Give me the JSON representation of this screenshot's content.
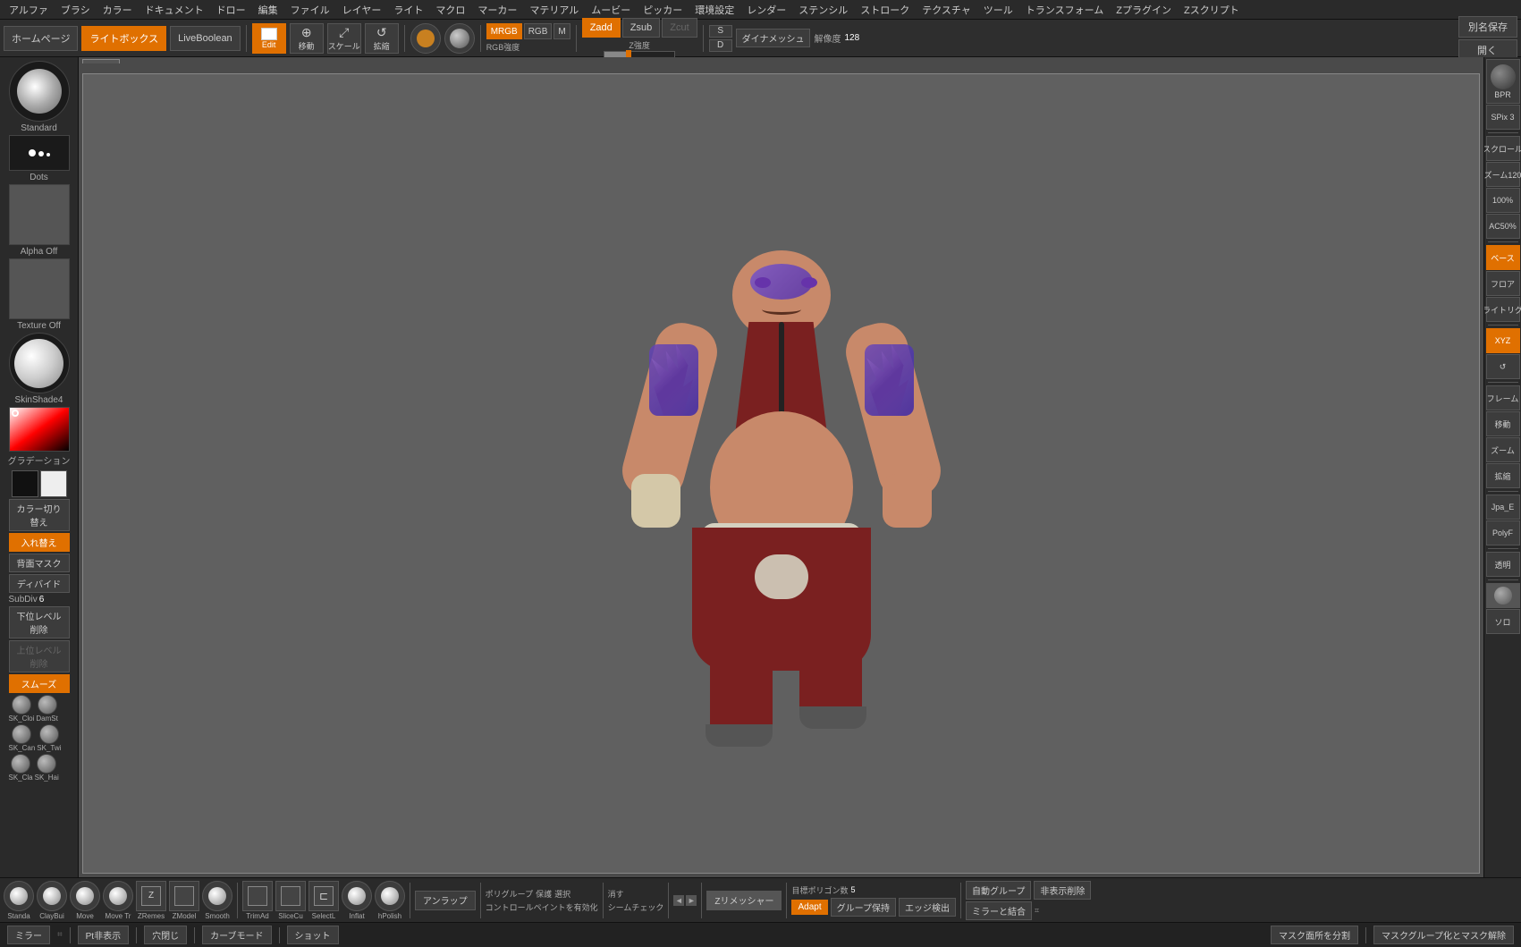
{
  "topMenu": {
    "items": [
      "アルファ",
      "ブラシ",
      "カラー",
      "ドキュメント",
      "ドロー",
      "編集",
      "ファイル",
      "レイヤー",
      "ライト",
      "マクロ",
      "マーカー",
      "マテリアル",
      "ムービー",
      "ピッカー",
      "環境設定",
      "レンダー",
      "ステンシル",
      "ストローク",
      "テクスチャ",
      "ツール",
      "トランスフォーム",
      "Zプラグイン",
      "Zスクリプト"
    ]
  },
  "toolbar": {
    "homeBtn": "ホームページ",
    "lightboxBtn": "ライトボックス",
    "liveBoolBtn": "LiveBoolean",
    "editBtn": "Edit",
    "moveBtn": "移動",
    "scaleBtn": "スケール",
    "rotateBtn": "拡縮",
    "mrgbLabel": "MRGB",
    "rgbLabel": "RGB",
    "mLabel": "M",
    "zaddLabel": "Zadd",
    "zsubLabel": "Zsub",
    "zcutLabel": "Zcut",
    "zIntensityLabel": "Z強度",
    "zIntensityValue": "25",
    "rgbIntensityLabel": "RGB強度",
    "dynameshLabel": "ダイナメッシュ",
    "kaizodoLabel": "解像度",
    "kaizodoValue": "128",
    "betsumeiLabel": "別名保存",
    "hirakulLabel": "開く",
    "sBtn": "S",
    "dBtn": "D"
  },
  "leftPanel": {
    "brushLabel": "Standard",
    "dotsLabel": "Dots",
    "alphaLabel": "Alpha Off",
    "textureLabel": "Texture Off",
    "materialLabel": "SkinShade4",
    "gradLabel": "グラデーション",
    "colorToggleLabel": "カラー切り替え",
    "irekaeLabel": "入れ替え",
    "backMaskLabel": "背面マスク",
    "dibideLabel": "ディバイド",
    "subdivLabel": "SubDiv",
    "subdivValue": "6",
    "lowerDeleteLabel": "下位レベル削除",
    "upperDeleteLabel": "上位レベル削除",
    "smoothLabel": "スムーズ",
    "brush1": "SK_Cloi",
    "brush2": "DamSt",
    "brush3": "SK_Can",
    "brush4": "SK_Twi",
    "brush5": "SK_Cla",
    "brush6": "SK_Hai"
  },
  "rightPanel": {
    "bprLabel": "BPR",
    "spixLabel": "SPix 3",
    "scroll1": "スクロール",
    "zoom1": "ズーム120",
    "zoom2": "100%",
    "ac1": "AC50%",
    "baseLabel": "ベース",
    "floorLabel": "フロア",
    "lightrig": "ライトリグ",
    "xyzLabel": "XYZ",
    "btn1": "フレーム",
    "btn2": "移動",
    "btn3": "ズーム",
    "btn4": "拡縮",
    "btn5": "Jpa_E",
    "btn6": "PolyF",
    "transparentLabel": "透明",
    "soloLabel": "ソロ"
  },
  "bottomToolbar": {
    "brushes": [
      "Standa",
      "ClayBui",
      "Move",
      "Move Tr",
      "ZRemes",
      "ZModel",
      "Smooth"
    ],
    "tools": [
      "TrimAd",
      "SliceCu",
      "SelectL",
      "Inflat",
      "hPolish"
    ],
    "anrapBtn": "アンラップ",
    "polygroupLabel": "ポリグループ",
    "hozonLabel": "保護",
    "sentakuLabel": "選択",
    "kesuLabel": "消す",
    "shimcheckLabel": "シームチェック",
    "zremesherBtn": "Zリメッシャー",
    "targetPolyLabel": "目標ポリゴン数",
    "targetPolyValue": "5",
    "adaptBtn": "Adapt",
    "groupHoldBtn": "グループ保持",
    "edgeDetectBtn": "エッジ検出",
    "autoGroupBtn": "自動グループ",
    "hideDeleteBtn": "非表示削除",
    "mirrorMergeBtn": "ミラーと結合",
    "maskGroupBtn": "マスクグループ化とマスク解除",
    "controlPaintLabel": "コントロールペイントを有効化"
  },
  "statusBar": {
    "mirrorBtn": "ミラー",
    "ptFaceBtn": "Pt非表示",
    "holeFillBtn": "穴閉じ",
    "curveBtn": "カーブモード",
    "shotBtn": "ショット",
    "maskSplitBtn": "マスク面所を分割"
  },
  "canvas": {
    "tab": ""
  }
}
